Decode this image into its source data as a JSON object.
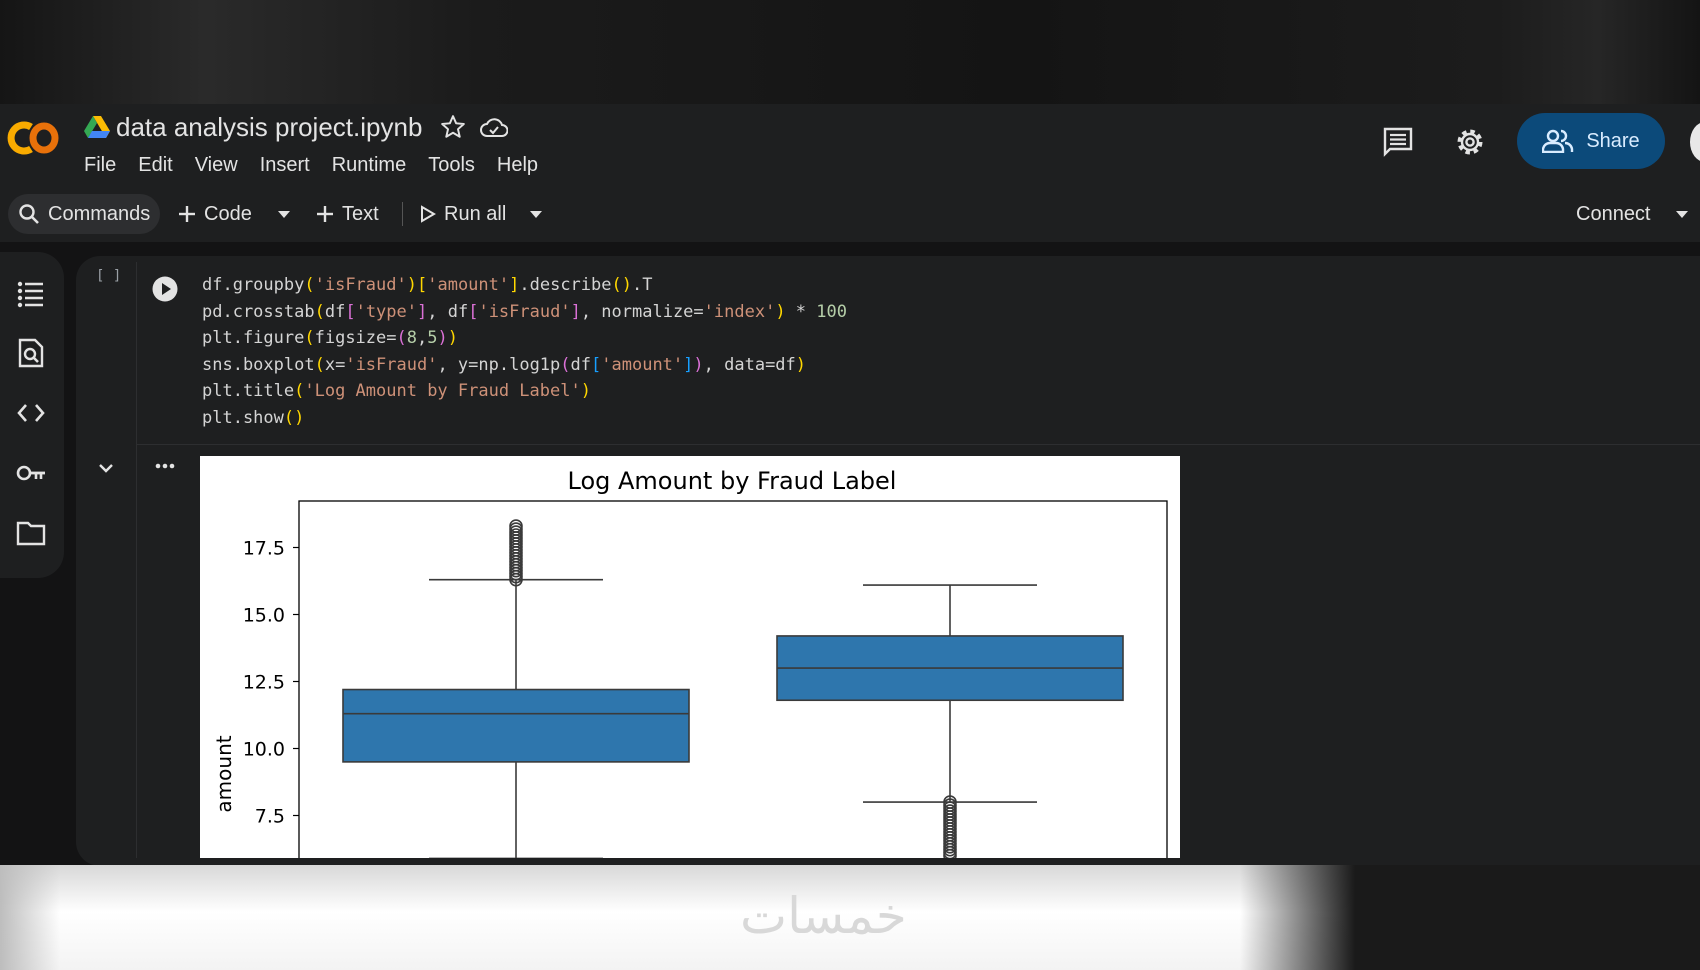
{
  "header": {
    "notebook_title": "data analysis project.ipynb",
    "menu": [
      "File",
      "Edit",
      "View",
      "Insert",
      "Runtime",
      "Tools",
      "Help"
    ],
    "share_label": "Share"
  },
  "toolbar": {
    "commands_label": "Commands",
    "code_label": "Code",
    "text_label": "Text",
    "run_all_label": "Run all",
    "connect_label": "Connect"
  },
  "sidebar": {
    "icons": [
      "table-of-contents-icon",
      "find-replace-icon",
      "code-snippets-icon",
      "secrets-key-icon",
      "files-folder-icon"
    ]
  },
  "cell": {
    "execution_count": "[ ]"
  },
  "watermark": "خمسات",
  "colors": {
    "accent": "#0c4a7a",
    "box_fill": "#2e76ad",
    "logo_orange": "#f9ab00"
  },
  "chart_data": {
    "type": "box",
    "title": "Log Amount by Fraud Label",
    "ylabel": "amount",
    "xlabel": "",
    "yticks": [
      7.5,
      10.0,
      12.5,
      15.0,
      17.5
    ],
    "ytick_labels": [
      "7.5",
      "10.0",
      "12.5",
      "15.0",
      "17.5"
    ],
    "ylim": [
      5.9,
      18.8
    ],
    "grid": false,
    "series": [
      {
        "q1": 9.5,
        "median": 11.3,
        "q3": 12.2,
        "whisker_low": 5.9,
        "whisker_high": 16.3,
        "outlier_range": [
          16.3,
          18.3
        ]
      },
      {
        "q1": 11.8,
        "median": 13.0,
        "q3": 14.2,
        "whisker_low": 8.0,
        "whisker_high": 16.1,
        "outlier_range": [
          6.0,
          8.0
        ]
      }
    ]
  }
}
